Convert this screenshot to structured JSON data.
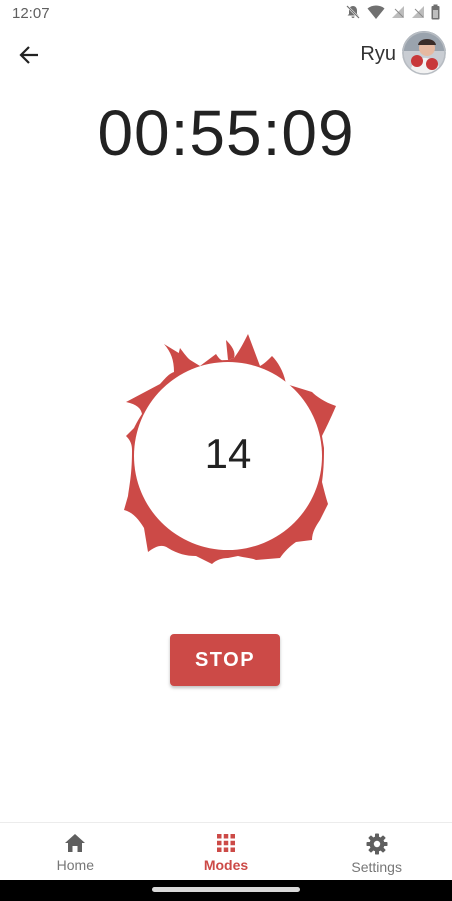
{
  "status_bar": {
    "time": "12:07"
  },
  "app_bar": {
    "user_name": "Ryu"
  },
  "timer": {
    "elapsed": "00:55:09"
  },
  "counter": {
    "value": "14"
  },
  "actions": {
    "stop_label": "STOP"
  },
  "bottom_nav": {
    "items": [
      {
        "label": "Home",
        "icon": "home-icon",
        "active": false
      },
      {
        "label": "Modes",
        "icon": "grid-icon",
        "active": true
      },
      {
        "label": "Settings",
        "icon": "gear-icon",
        "active": false
      }
    ]
  },
  "colors": {
    "accent": "#cc4a47",
    "text": "#222222",
    "inactive": "#777777"
  }
}
